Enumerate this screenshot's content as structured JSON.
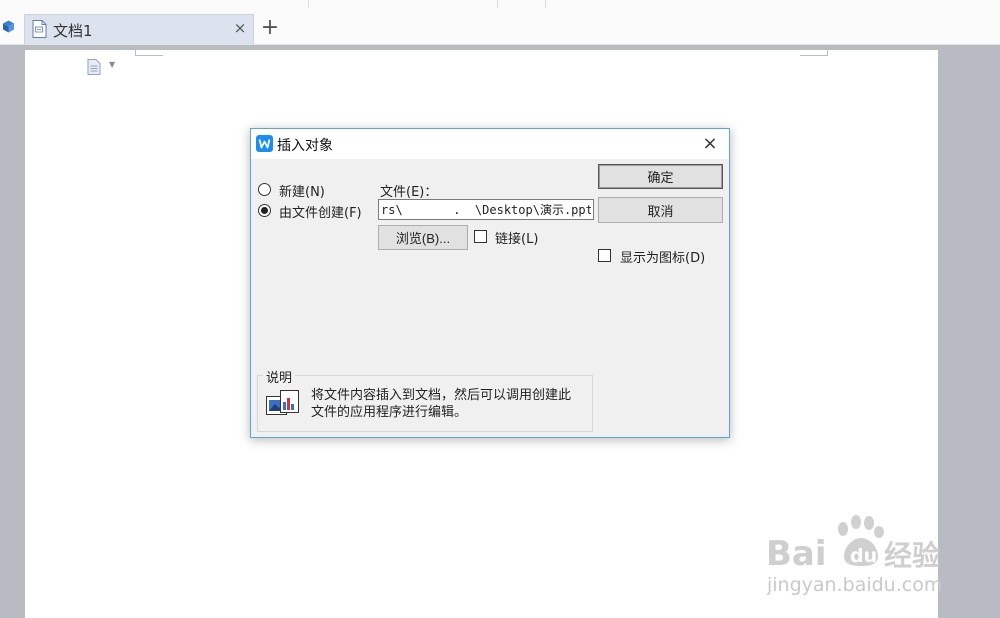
{
  "tab": {
    "title": "文档1",
    "close_glyph": "×",
    "new_glyph": "+"
  },
  "icons": {
    "app": "cube-icon",
    "tab_document": "document-icon",
    "page_paragraph": "paragraph-icon",
    "dialog_logo": "wps-writer-logo-icon",
    "description": "embedded-object-icon",
    "dialog_close": "close-icon"
  },
  "dialog": {
    "title": "插入对象",
    "close_glyph": "×",
    "options": {
      "new": "新建(N)",
      "from_file": "由文件创建(F)"
    },
    "selected_option": "from_file",
    "file": {
      "label": "文件(E)：",
      "value": "rs\\       .  \\Desktop\\演示.pptx"
    },
    "browse_button": "浏览(B)...",
    "link_checkbox": {
      "label": "链接(L)",
      "checked": false
    },
    "ok_button": "确定",
    "cancel_button": "取消",
    "display_as_icon_checkbox": {
      "label": "显示为图标(D)",
      "checked": false
    },
    "description": {
      "group_label": "说明",
      "text": "将文件内容插入到文档，然后可以调用创建此文件的应用程序进行编辑。"
    }
  },
  "watermark": {
    "brand": "Baidu经验",
    "domain": "jingyan.baidu.com"
  },
  "colors": {
    "background": "#b9bbc2",
    "tab_active": "#dce3ee",
    "dialog_border": "#62a2dc",
    "wps_blue": "#1c8ef2",
    "watermark": "#c9c9c9"
  }
}
